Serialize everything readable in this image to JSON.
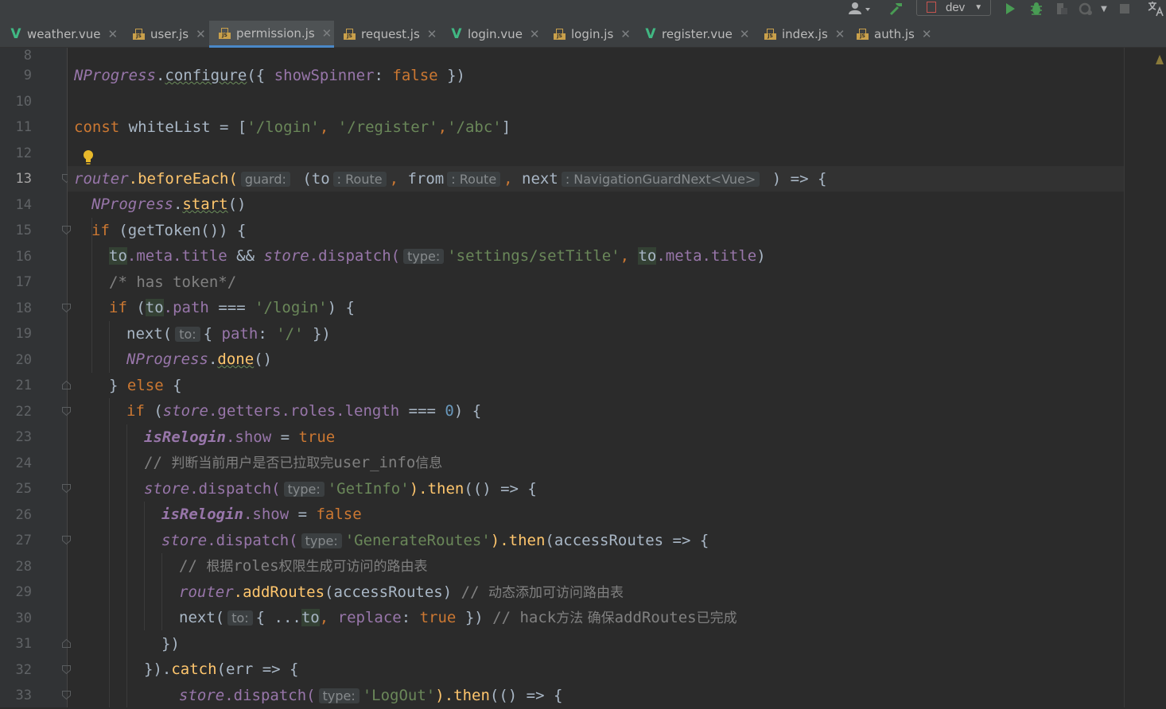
{
  "toolbar": {
    "branch": "dev",
    "colors": {
      "run": "#499c54",
      "build": "#499c54",
      "dropdown_text": "#bbbbbb"
    }
  },
  "tabs": [
    {
      "label": "weather.vue",
      "type": "vue",
      "active": false
    },
    {
      "label": "user.js",
      "type": "js",
      "active": false
    },
    {
      "label": "permission.js",
      "type": "js",
      "active": true
    },
    {
      "label": "request.js",
      "type": "js",
      "active": false
    },
    {
      "label": "login.vue",
      "type": "vue",
      "active": false
    },
    {
      "label": "login.js",
      "type": "js",
      "active": false
    },
    {
      "label": "register.vue",
      "type": "vue",
      "active": false
    },
    {
      "label": "index.js",
      "type": "js",
      "active": false
    },
    {
      "label": "auth.js",
      "type": "js",
      "active": false
    }
  ],
  "editor": {
    "line_numbers": [
      "8",
      "9",
      "10",
      "11",
      "12",
      "13",
      "14",
      "15",
      "16",
      "17",
      "18",
      "19",
      "20",
      "21",
      "22",
      "23",
      "24",
      "25",
      "26",
      "27",
      "28",
      "29",
      "30",
      "31",
      "32",
      "33"
    ],
    "current_line": "13",
    "hints": {
      "guard": "guard:",
      "route_type": ": Route",
      "guard_next_type": ": NavigationGuardNext<Vue>",
      "type": "type:",
      "to": "to:"
    },
    "code": {
      "l9": {
        "obj": "NProgress",
        "method": "configure",
        "open": "({ ",
        "prop": "showSpinner",
        "colon": ": ",
        "val": "false",
        "close": " })"
      },
      "l11": {
        "kw": "const",
        "name": " whiteList = [",
        "s1": "'/login'",
        "c1": ", ",
        "s2": "'/register'",
        "c2": ",",
        "s3": "'/abc'",
        "close": "]"
      },
      "l13": {
        "obj": "router",
        "method": ".beforeEach(",
        "p_open": " (",
        "p_to": "to",
        "comma": ", ",
        "p_from": "from",
        "p_next": "next",
        "close": " ) => {"
      },
      "l14": {
        "obj": "NProgress",
        "method": "start",
        "end": "()"
      },
      "l15": {
        "kw": "if",
        "body": " (getToken()) {"
      },
      "l16": {
        "to": "to",
        "meta": ".meta.",
        "title": "title",
        "and": " && ",
        "store": "store",
        "dispatch": ".dispatch(",
        "str": "'settings/setTitle'",
        "comma": ", ",
        "to2": "to",
        "meta2": ".meta.",
        "title2": "title",
        "close": ")"
      },
      "l17": {
        "comment": "/* has token*/"
      },
      "l18": {
        "kw": "if",
        "open": " (",
        "to": "to",
        "path": ".path",
        "eq": " === ",
        "str": "'/login'",
        "close": ") {"
      },
      "l19": {
        "fn": "next(",
        "open": "{ ",
        "prop": "path",
        "colon": ": ",
        "str": "'/'",
        "close": " })"
      },
      "l20": {
        "obj": "NProgress",
        "method": "done",
        "end": "()"
      },
      "l21": {
        "brace": "} ",
        "kw": "else",
        "open": " {"
      },
      "l22": {
        "kw": "if",
        "open": " (",
        "store": "store",
        "getters": ".getters.",
        "roles": "roles",
        "length": ".length",
        "eq": " === ",
        "num": "0",
        "close": ") {"
      },
      "l23": {
        "obj": "isRelogin",
        "prop": ".show",
        "eq": " = ",
        "val": "true"
      },
      "l24": {
        "slashes": "// ",
        "zh1": "判断当前用户是否已拉取完",
        "mono": "user_info",
        "zh2": "信息"
      },
      "l25": {
        "store": "store",
        "dispatch": ".dispatch(",
        "str": "'GetInfo'",
        "then": ").then",
        "rest": "(() => {"
      },
      "l26": {
        "obj": "isRelogin",
        "prop": ".show",
        "eq": " = ",
        "val": "false"
      },
      "l27": {
        "store": "store",
        "dispatch": ".dispatch(",
        "str": "'GenerateRoutes'",
        "then": ").then",
        "rest": "(accessRoutes => {"
      },
      "l28": {
        "slashes": "// ",
        "zh1": "根据",
        "mono": "roles",
        "zh2": "权限生成可访问的路由表"
      },
      "l29": {
        "obj": "router",
        "method": ".addRoutes",
        "args": "(accessRoutes) ",
        "slashes": "// ",
        "zh": "动态添加可访问路由表"
      },
      "l30": {
        "fn": "next(",
        "open": "{ ...",
        "to": "to",
        "comma": ", ",
        "prop": "replace",
        "colon": ": ",
        "val": "true",
        "close": " }) ",
        "slashes": "// ",
        "m1": "hack",
        "zh1": "方法 确保",
        "m2": "addRoutes",
        "zh2": "已完成"
      },
      "l31": {
        "text": "})"
      },
      "l32": {
        "close": "}).",
        "catch": "catch",
        "rest": "(err => {"
      },
      "l33": {
        "store": "store",
        "dispatch": ".dispatch(",
        "str": "'LogOut'",
        "then": ").then",
        "rest": "(() => {"
      }
    }
  }
}
